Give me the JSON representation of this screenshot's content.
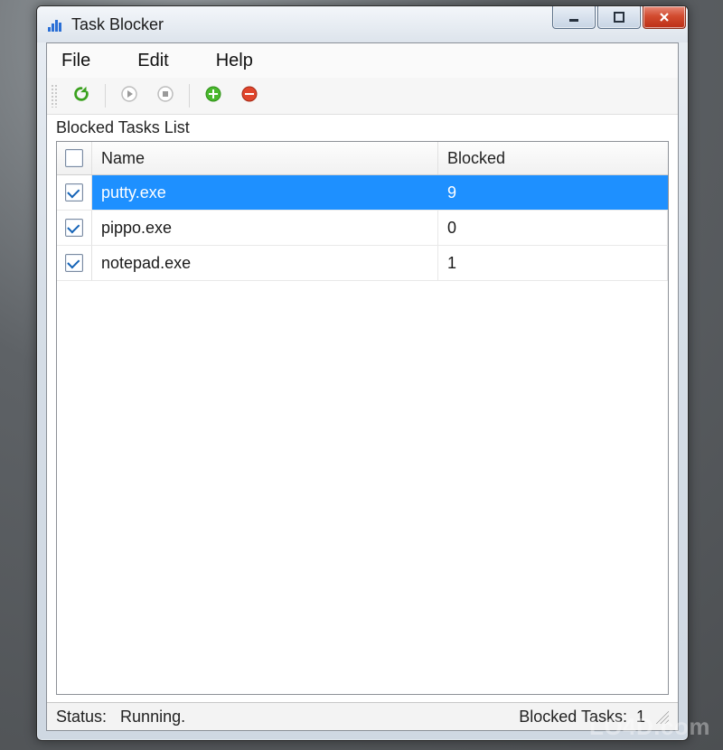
{
  "window": {
    "title": "Task Blocker"
  },
  "menubar": {
    "items": [
      "File",
      "Edit",
      "Help"
    ]
  },
  "toolbar": {
    "refresh": "refresh",
    "play": "play",
    "stop": "stop",
    "add": "add",
    "remove": "remove"
  },
  "list": {
    "label": "Blocked Tasks List",
    "columns": {
      "name": "Name",
      "blocked": "Blocked"
    },
    "header_checked": false,
    "rows": [
      {
        "checked": true,
        "selected": true,
        "name": "putty.exe",
        "blocked": "9"
      },
      {
        "checked": true,
        "selected": false,
        "name": "pippo.exe",
        "blocked": "0"
      },
      {
        "checked": true,
        "selected": false,
        "name": "notepad.exe",
        "blocked": "1"
      }
    ]
  },
  "status": {
    "left_label": "Status:",
    "state": "Running.",
    "right_label": "Blocked Tasks:",
    "count": "1"
  },
  "watermark": "LO4D.com"
}
